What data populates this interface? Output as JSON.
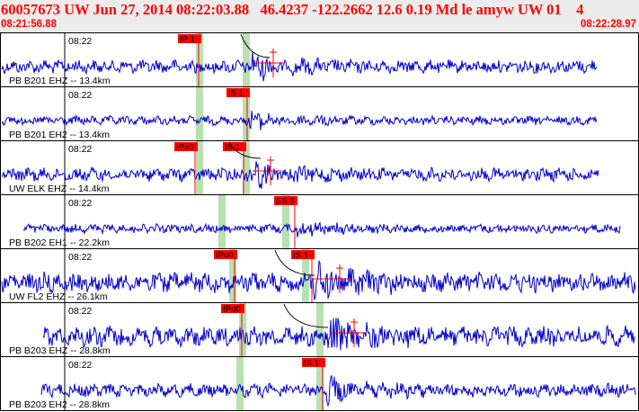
{
  "header": {
    "title": "60057673 UW Jun 27, 2014 08:22:03.88   46.4237 -122.2662 12.6 0.19 Md le amyw UW 01    4",
    "start_time": "08:21:56.88",
    "end_time": "08:22:28.97"
  },
  "colors": {
    "header_text": "#ff0000",
    "trace": "#0000cc",
    "pick_box": "#ff0000",
    "pick_window": "#b8e0b0",
    "panel_border": "#000000"
  },
  "traces": [
    {
      "name": "PB B201 EHZ -- 13.4km",
      "time_label": "08:22",
      "amplitude": "medium",
      "picks": [
        {
          "label": "IP 1"
        }
      ],
      "has_moveout_curve": true,
      "has_coda_marker": true
    },
    {
      "name": "PB B201 EH2 -- 13.4km",
      "time_label": "08:22",
      "amplitude": "low",
      "picks": [
        {
          "label": "IS 1"
        }
      ],
      "has_moveout_curve": false,
      "has_coda_marker": false
    },
    {
      "name": "UW ELK EHZ -- 14.4km",
      "time_label": "08:22",
      "amplitude": "medium",
      "picks": [
        {
          "label": "IPx0"
        },
        {
          "label": "IS 1"
        }
      ],
      "has_moveout_curve": true,
      "has_coda_marker": true
    },
    {
      "name": "PB B202 EH1 -- 22.2km",
      "time_label": "08:22",
      "amplitude": "low",
      "picks": [
        {
          "label": "ES 2"
        }
      ],
      "has_moveout_curve": false,
      "has_coda_marker": false
    },
    {
      "name": "UW FL2 EHZ -- 26.1km",
      "time_label": "08:22",
      "amplitude": "high",
      "picks": [
        {
          "label": "IPd0"
        },
        {
          "label": "IS 1"
        }
      ],
      "has_moveout_curve": true,
      "has_coda_marker": true
    },
    {
      "name": "PB B203 EHZ -- 28.8km",
      "time_label": "08:22",
      "amplitude": "high",
      "picks": [
        {
          "label": "IPd0"
        }
      ],
      "has_moveout_curve": true,
      "has_coda_marker": true
    },
    {
      "name": "PB B203 EH2 -- 28.8km",
      "time_label": "08:22",
      "amplitude": "medium",
      "picks": [
        {
          "label": "IS 1"
        }
      ],
      "has_moveout_curve": false,
      "has_coda_marker": false
    }
  ]
}
